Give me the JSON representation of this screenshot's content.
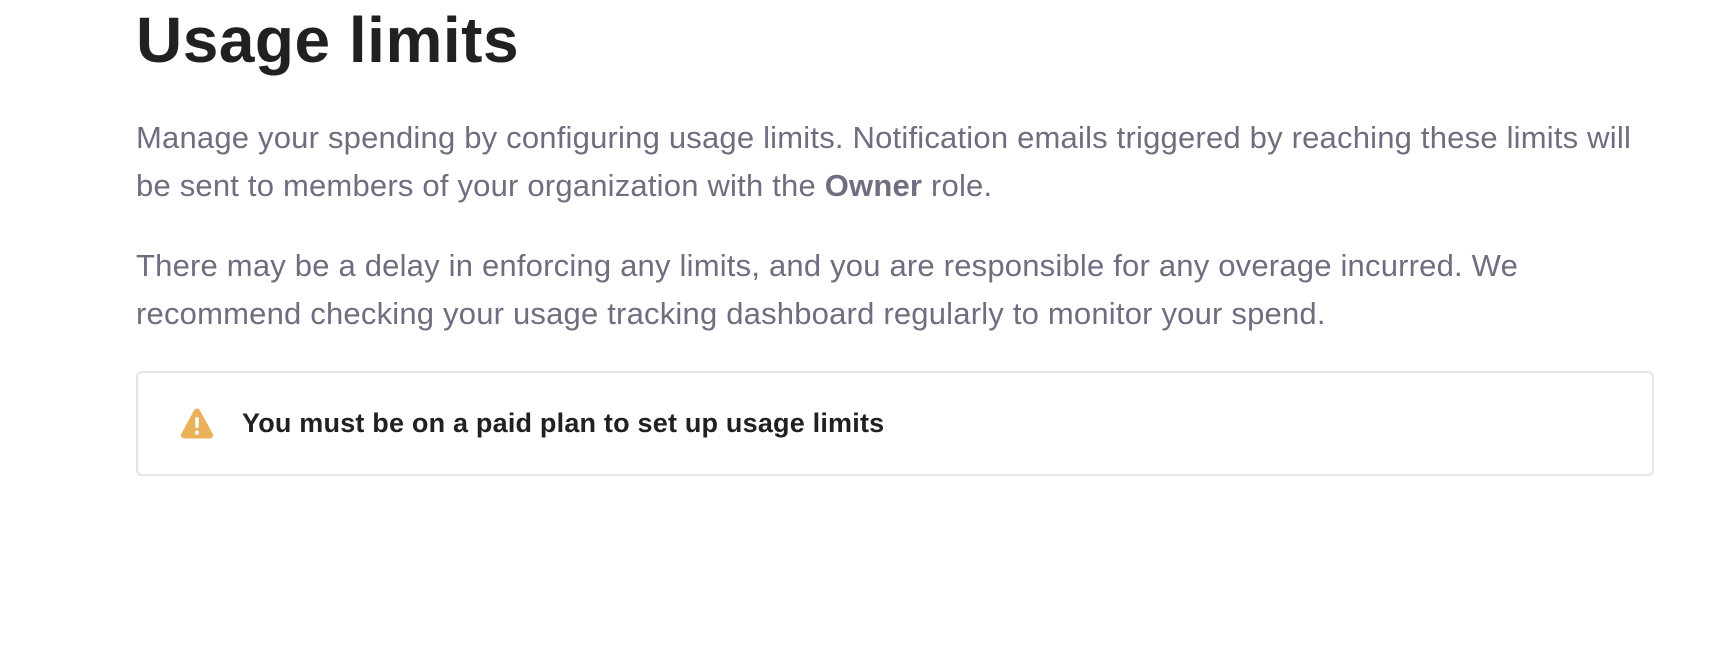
{
  "header": {
    "title": "Usage limits"
  },
  "description": {
    "paragraph1_prefix": "Manage your spending by configuring usage limits. Notification emails triggered by reaching these limits will be sent to members of your organization with the ",
    "paragraph1_bold": "Owner",
    "paragraph1_suffix": " role.",
    "paragraph2": "There may be a delay in enforcing any limits, and you are responsible for any overage incurred. We recommend checking your usage tracking dashboard regularly to monitor your spend."
  },
  "notice": {
    "icon": "warning-icon",
    "icon_color": "#e8b15a",
    "text": "You must be on a paid plan to set up usage limits"
  }
}
